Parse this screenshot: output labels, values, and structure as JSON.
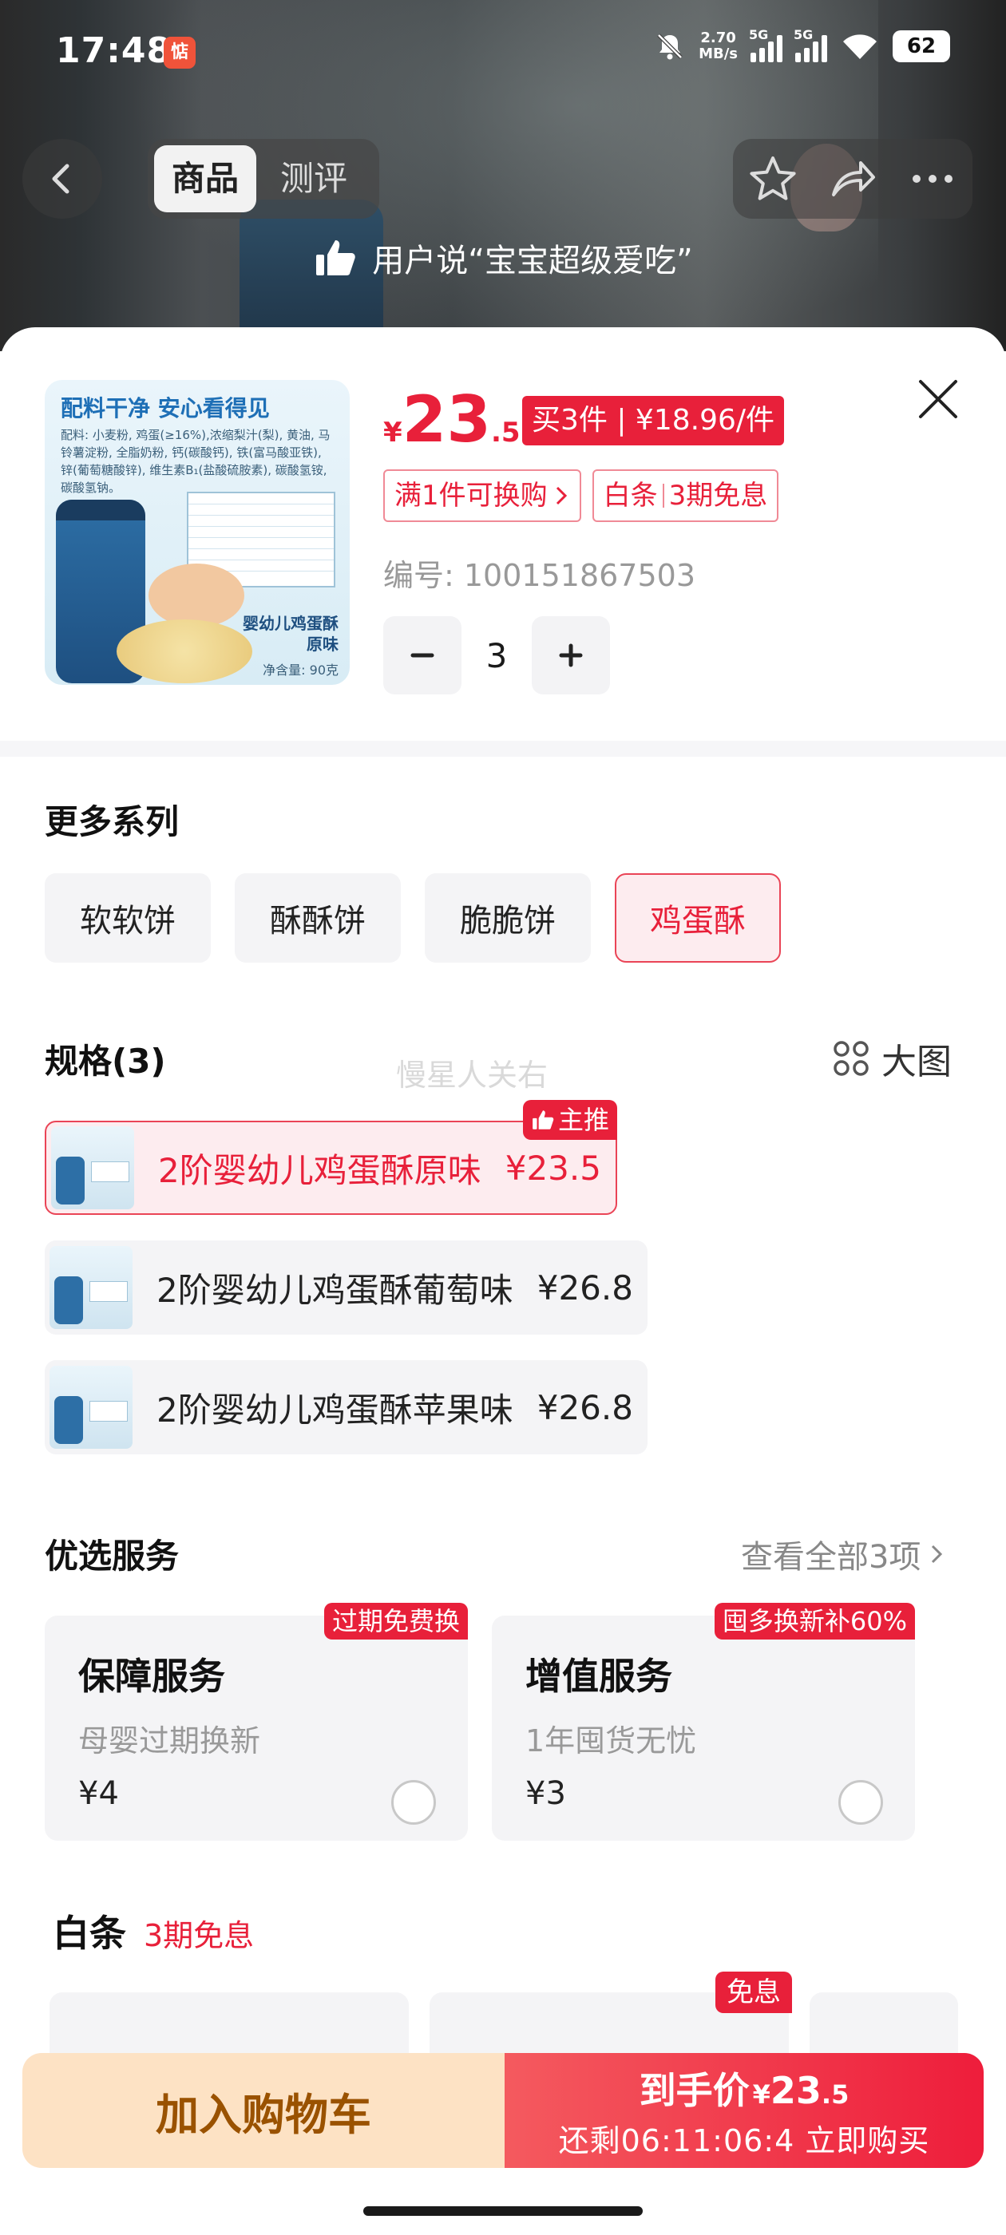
{
  "status_bar": {
    "time": "17:48",
    "app_badge": "惦",
    "net_speed_value": "2.70",
    "net_speed_unit": "MB/s",
    "signal_1": "5G",
    "signal_2": "5G",
    "battery": "62"
  },
  "nav": {
    "tabs": [
      {
        "label": "商品",
        "active": true
      },
      {
        "label": "测评",
        "active": false
      }
    ],
    "banner": "用户说“宝宝超级爱吃”"
  },
  "product": {
    "thumb_title": "配料干净  安心看得见",
    "thumb_ingredients": "配料: 小麦粉, 鸡蛋(≥16%),浓缩梨汁(梨), 黄油, 马铃薯淀粉, 全脂奶粉, 钙(碳酸钙), 铁(富马酸亚铁), 锌(葡萄糖酸锌), 维生素B₁(盐酸硫胺素), 碳酸氢铵, 碳酸氢钠。",
    "thumb_name": "婴幼儿鸡蛋酥\n原味",
    "thumb_weight": "净含量: 90克",
    "price_currency": "¥",
    "price_int": "23",
    "price_dec": ".5",
    "bulk_offer": "买3件 | ¥18.96/件",
    "promo_exchange": "满1件可换购",
    "promo_baitiao_label": "白条",
    "promo_baitiao_value": "3期免息",
    "sku_number": "编号: 100151867503",
    "quantity": "3"
  },
  "series": {
    "title": "更多系列",
    "options": [
      {
        "label": "软软饼",
        "selected": false
      },
      {
        "label": "酥酥饼",
        "selected": false
      },
      {
        "label": "脆脆饼",
        "selected": false
      },
      {
        "label": "鸡蛋酥",
        "selected": true
      }
    ]
  },
  "specs": {
    "title": "规格(3)",
    "big_image_label": "大图",
    "watermark": "慢星人关右",
    "recommend_tag": "主推",
    "items": [
      {
        "name": "2阶婴幼儿鸡蛋酥原味",
        "price": "¥23.5",
        "selected": true
      },
      {
        "name": "2阶婴幼儿鸡蛋酥葡萄味",
        "price": "¥26.8",
        "selected": false
      },
      {
        "name": "2阶婴幼儿鸡蛋酥苹果味",
        "price": "¥26.8",
        "selected": false
      }
    ]
  },
  "services": {
    "title": "优选服务",
    "see_all": "查看全部3项",
    "items": [
      {
        "badge": "过期免费换",
        "title": "保障服务",
        "desc": "母婴过期换新",
        "price": "¥4"
      },
      {
        "badge": "囤多换新补60%",
        "title": "增值服务",
        "desc": "1年囤货无忧",
        "price": "¥3"
      }
    ]
  },
  "baitiao": {
    "title": "白条",
    "subtitle": "3期免息",
    "plan_badge": "免息"
  },
  "bottom_bar": {
    "cart_label": "加入购物车",
    "buy_prefix": "到手价",
    "buy_currency": "¥",
    "buy_int": "23",
    "buy_dec": ".5",
    "countdown": "还剩06:11:06:4  立即购买"
  },
  "colors": {
    "accent_red": "#e8203a",
    "cart_bg": "#fde2c4",
    "cart_text": "#9a5200"
  }
}
